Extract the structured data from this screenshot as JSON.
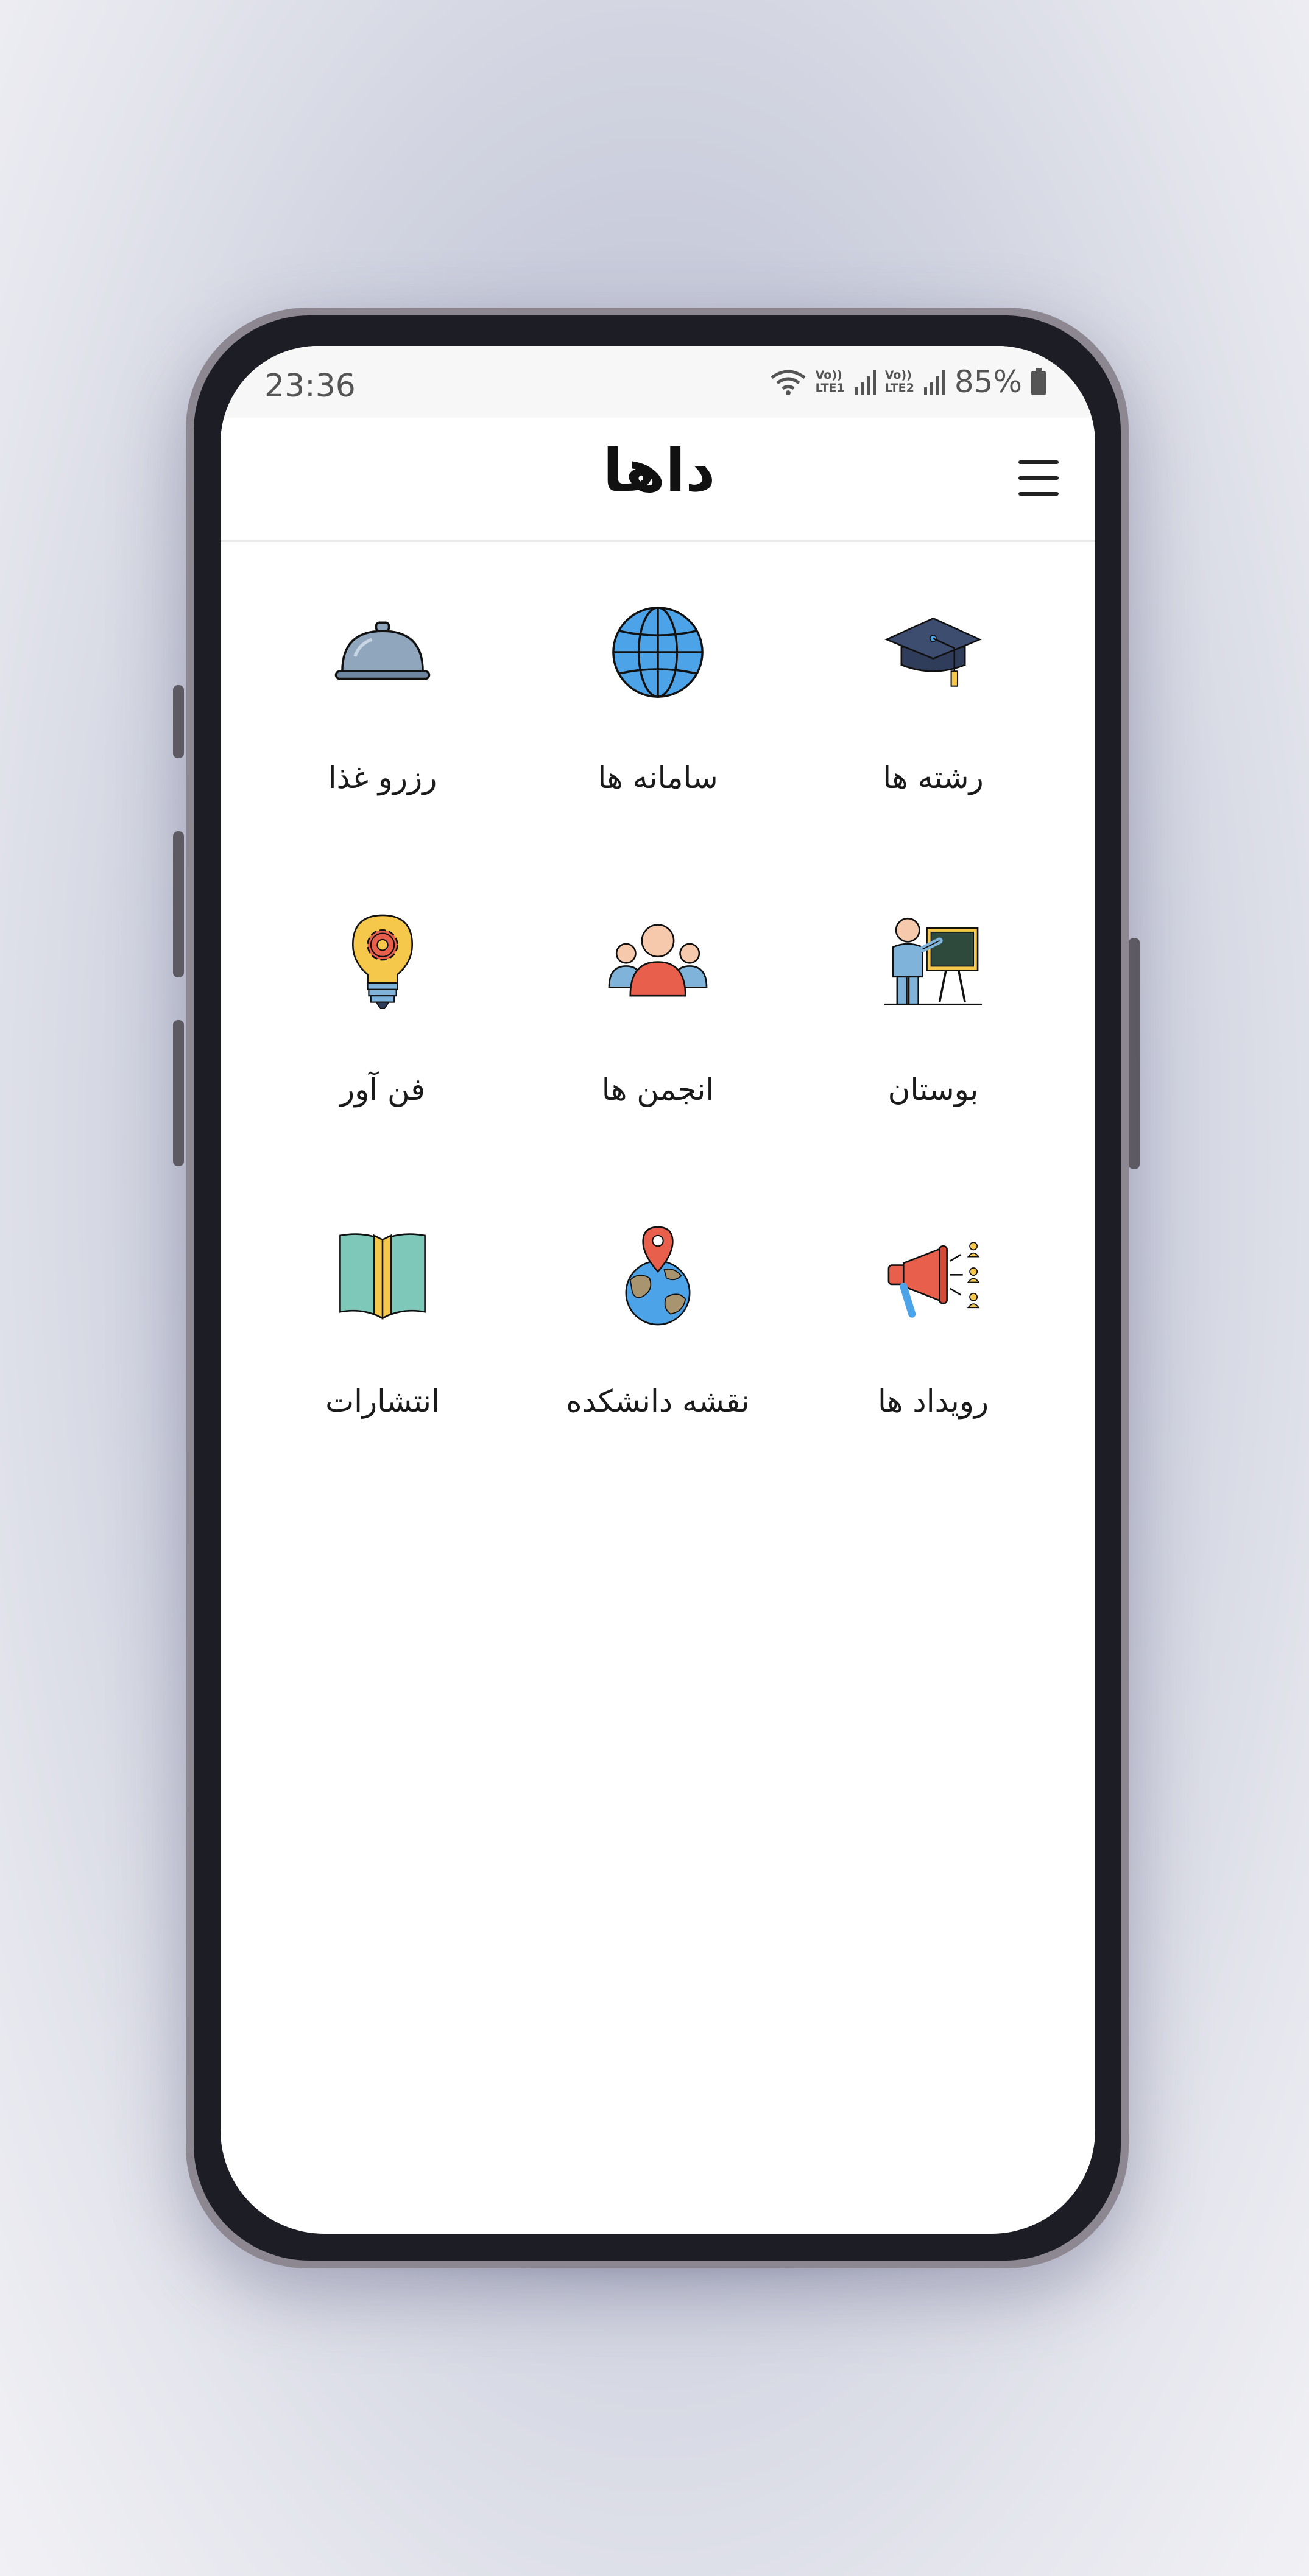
{
  "status_bar": {
    "time": "23:36",
    "sim1_top": "Vo))",
    "sim1_bottom": "LTE1",
    "sim2_top": "Vo))",
    "sim2_bottom": "LTE2",
    "battery": "85%"
  },
  "header": {
    "logo_text": "داها",
    "menu_icon": "hamburger-menu-icon"
  },
  "grid": {
    "items": [
      {
        "label": "رشته ها",
        "icon": "graduation-cap-icon"
      },
      {
        "label": "سامانه ها",
        "icon": "globe-icon"
      },
      {
        "label": "رزرو غذا",
        "icon": "food-cloche-icon"
      },
      {
        "label": "بوستان",
        "icon": "teacher-board-icon"
      },
      {
        "label": "انجمن ها",
        "icon": "people-group-icon"
      },
      {
        "label": "فن آور",
        "icon": "lightbulb-gear-icon"
      },
      {
        "label": "رویداد ها",
        "icon": "megaphone-icon"
      },
      {
        "label": "نقشه دانشکده",
        "icon": "map-pin-globe-icon"
      },
      {
        "label": "انتشارات",
        "icon": "open-book-icon"
      }
    ]
  },
  "colors": {
    "navy": "#2f3c5a",
    "globe_blue": "#4da3e8",
    "cloche_gray": "#8fa6bd",
    "yellow": "#f5c84c",
    "red": "#e8604c",
    "skin": "#f6c9ad",
    "teal": "#7ec8b9",
    "board_green": "#2e4a3c"
  }
}
